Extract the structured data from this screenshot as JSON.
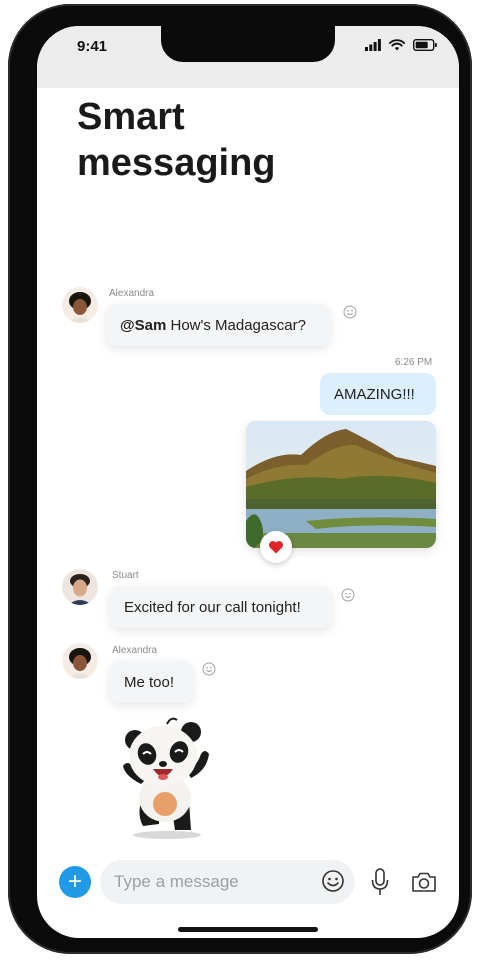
{
  "status_bar": {
    "time": "9:41"
  },
  "headline": {
    "line1": "Smart",
    "line2": "messaging"
  },
  "conversation": {
    "msg1": {
      "sender": "Alexandra",
      "mention": "@Sam",
      "text": " How's Madagascar?"
    },
    "timestamp": "6:26 PM",
    "reply": {
      "text": "AMAZING!!!"
    },
    "msg2": {
      "sender": "Stuart",
      "text": "Excited for our call tonight!"
    },
    "msg3": {
      "sender": "Alexandra",
      "text": "Me too!"
    }
  },
  "composer": {
    "placeholder": "Type a message"
  },
  "colors": {
    "accent": "#1e9ae6",
    "outgoing_bubble": "#dcefff",
    "heart": "#e02424"
  }
}
